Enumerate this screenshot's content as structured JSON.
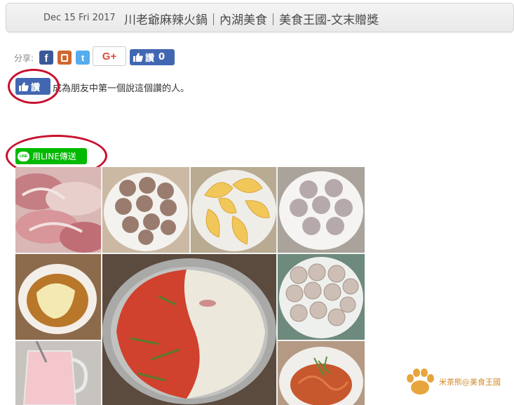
{
  "post": {
    "date": "Dec 15 Fri 2017",
    "title": "川老爺麻辣火鍋｜內湖美食｜美食王國-文末贈獎"
  },
  "share": {
    "label": "分享:",
    "gplus_label": "G+",
    "like_label": "讚",
    "like_count": "0"
  },
  "like_box": {
    "button_label": "讚",
    "prompt": "成為朋友中第一個說這個讚的人。"
  },
  "line_share": {
    "badge": "LINE",
    "label": "用LINE傳送"
  },
  "watermark": {
    "text": "米茶熊@美食王國"
  },
  "colors": {
    "facebook": "#3b5998",
    "plurk": "#cf682f",
    "twitter": "#55acee",
    "gplus": "#dd4b39",
    "like_blue": "#4267b2",
    "line_green": "#00b900",
    "annotation_red": "#c8102e",
    "watermark_orange": "#e7a53d"
  },
  "icons": [
    "facebook-icon",
    "plurk-icon",
    "twitter-icon",
    "google-plus-icon",
    "thumbs-up-icon",
    "line-icon",
    "paw-icon"
  ]
}
